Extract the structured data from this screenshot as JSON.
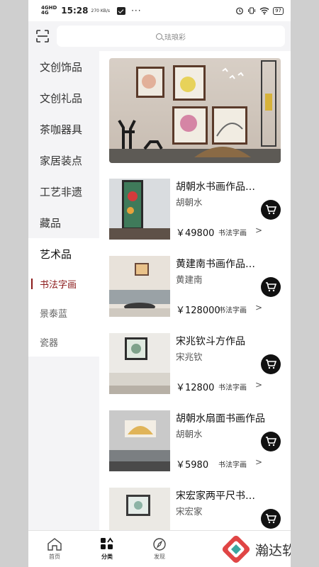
{
  "status_bar": {
    "network": "4GHD",
    "network_sub": "4G",
    "time": "15:28",
    "speed": "270 KB/s",
    "more": "···",
    "battery": "97"
  },
  "search": {
    "placeholder": "珐琅彩"
  },
  "sidebar": {
    "categories": [
      {
        "label": "文创饰品"
      },
      {
        "label": "文创礼品"
      },
      {
        "label": "茶咖器具"
      },
      {
        "label": "家居装点"
      },
      {
        "label": "工艺非遗"
      },
      {
        "label": "藏品"
      },
      {
        "label": "艺术品"
      }
    ],
    "subcategories": [
      {
        "label": "书法字画"
      },
      {
        "label": "景泰蓝"
      },
      {
        "label": "瓷器"
      }
    ]
  },
  "products": [
    {
      "title": "胡朝水书画作品…",
      "author": "胡朝水",
      "price": "￥49800",
      "category": "书法字画",
      "chevron": ">"
    },
    {
      "title": "黄建南书画作品…",
      "author": "黄建南",
      "price": "￥128000",
      "category": "书法字画",
      "chevron": ">"
    },
    {
      "title": "宋兆钦斗方作品",
      "author": "宋兆钦",
      "price": "￥12800",
      "category": "书法字画",
      "chevron": ">"
    },
    {
      "title": "胡朝水扇面书画作品",
      "author": "胡朝水",
      "price": "￥5980",
      "category": "书法字画",
      "chevron": ">"
    },
    {
      "title": "宋宏家两平尺书…",
      "author": "宋宏家",
      "price": "",
      "category": "",
      "chevron": ""
    }
  ],
  "bottom_nav": [
    {
      "label": "首页",
      "icon": "home-icon"
    },
    {
      "label": "分类",
      "icon": "category-icon"
    },
    {
      "label": "发现",
      "icon": "compass-icon"
    }
  ],
  "watermark": {
    "text": "瀚达软件园"
  },
  "colors": {
    "accent": "#8b1a1a",
    "sidebar_bg": "#f4f4f6",
    "cart_bg": "#111111"
  }
}
